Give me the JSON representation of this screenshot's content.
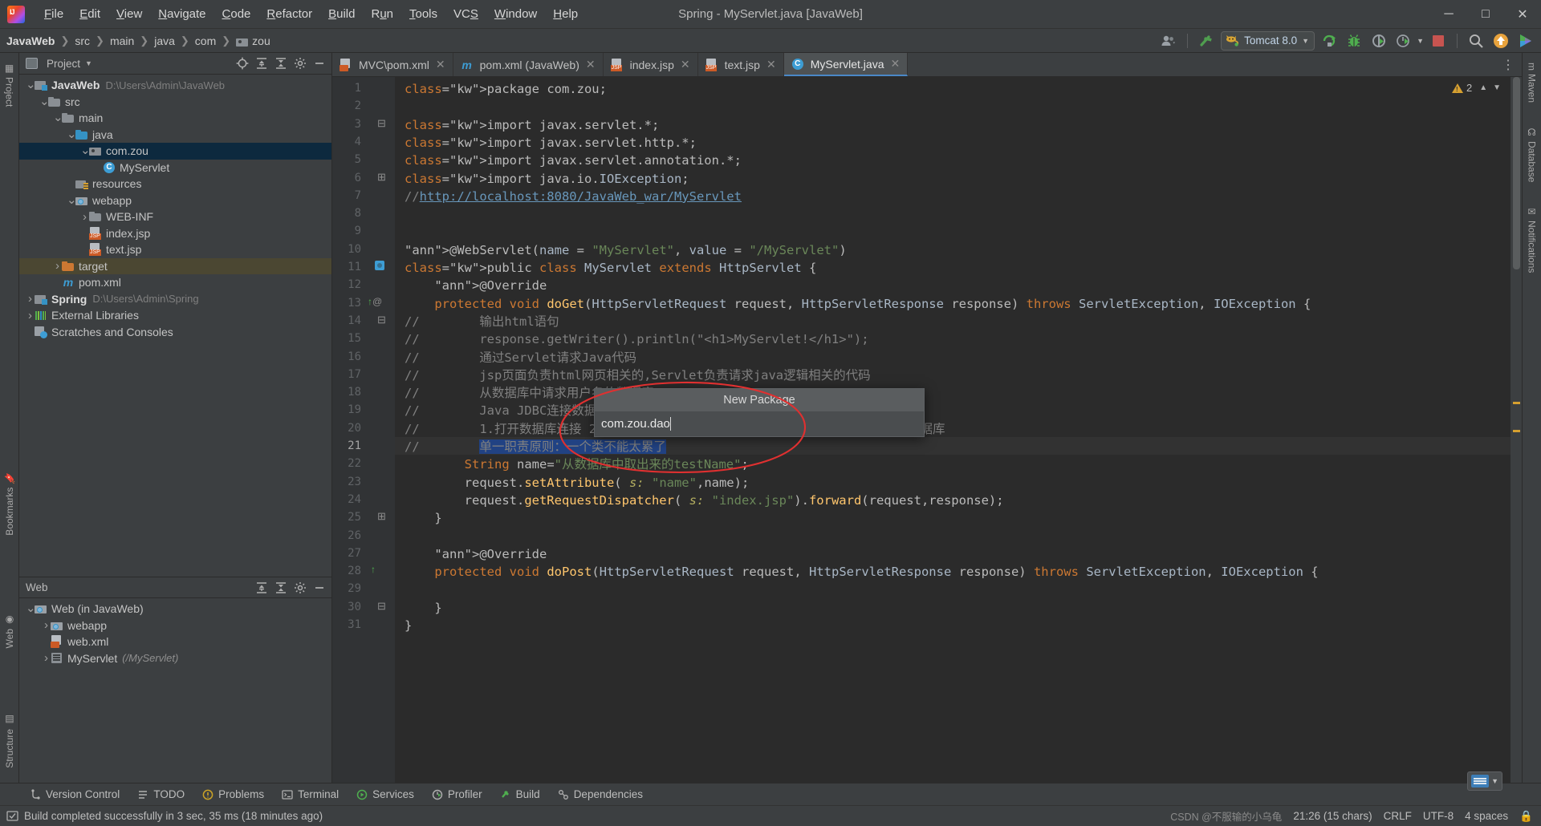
{
  "window": {
    "title": "Spring - MyServlet.java [JavaWeb]",
    "logo_icon": "intellij-idea-logo",
    "minimize_icon": "minimize-icon",
    "maximize_icon": "maximize-icon",
    "close_icon": "close-icon"
  },
  "menu": [
    {
      "label": "File"
    },
    {
      "label": "Edit"
    },
    {
      "label": "View"
    },
    {
      "label": "Navigate"
    },
    {
      "label": "Code"
    },
    {
      "label": "Refactor"
    },
    {
      "label": "Build"
    },
    {
      "label": "Run"
    },
    {
      "label": "Tools"
    },
    {
      "label": "VCS"
    },
    {
      "label": "Window"
    },
    {
      "label": "Help"
    }
  ],
  "breadcrumb": [
    {
      "label": "JavaWeb",
      "bold": true,
      "icon": ""
    },
    {
      "label": "src",
      "bold": false,
      "icon": ""
    },
    {
      "label": "main",
      "bold": false,
      "icon": ""
    },
    {
      "label": "java",
      "bold": false,
      "icon": ""
    },
    {
      "label": "com",
      "bold": false,
      "icon": ""
    },
    {
      "label": "zou",
      "bold": false,
      "icon": "package-icon"
    }
  ],
  "toolbar": {
    "account_icon": "user-account-icon",
    "account_caret": "chevron-down-icon",
    "build_icon": "build-hammer-icon",
    "run_config": {
      "label": "Tomcat 8.0",
      "icon": "tomcat-cat-icon",
      "caret": "chevron-down-icon"
    },
    "run_icon": "run-icon",
    "debug_icon": "debug-bug-icon",
    "run_with_coverage_icon": "run-coverage-icon",
    "profiler_icon": "profiler-icon",
    "profiler_caret": "chevron-down-icon",
    "stop_icon": "stop-icon",
    "search_icon": "search-everywhere-icon",
    "update_icon": "update-project-icon",
    "plugin_icon": "run-anything-icon"
  },
  "project_panel": {
    "title": "Project",
    "title_caret": "chevron-down-icon",
    "actions": [
      "locate-icon",
      "expand-all-icon",
      "collapse-all-icon",
      "settings-gear-icon",
      "hide-panel-icon"
    ],
    "tree": [
      {
        "label": "JavaWeb",
        "path": "D:\\Users\\Admin\\JavaWeb",
        "indent": 0,
        "arrow": "v",
        "icon": "module-icon",
        "bold": true,
        "state": ""
      },
      {
        "label": "src",
        "path": "",
        "indent": 1,
        "arrow": "v",
        "icon": "folder-icon",
        "bold": false,
        "state": ""
      },
      {
        "label": "main",
        "path": "",
        "indent": 2,
        "arrow": "v",
        "icon": "folder-icon",
        "bold": false,
        "state": ""
      },
      {
        "label": "java",
        "path": "",
        "indent": 3,
        "arrow": "v",
        "icon": "source-folder-icon",
        "bold": false,
        "state": ""
      },
      {
        "label": "com.zou",
        "path": "",
        "indent": 4,
        "arrow": "v",
        "icon": "package-icon",
        "bold": false,
        "state": "selected"
      },
      {
        "label": "MyServlet",
        "path": "",
        "indent": 5,
        "arrow": "",
        "icon": "java-class-icon",
        "bold": false,
        "state": ""
      },
      {
        "label": "resources",
        "path": "",
        "indent": 3,
        "arrow": "",
        "icon": "resources-folder-icon",
        "bold": false,
        "state": ""
      },
      {
        "label": "webapp",
        "path": "",
        "indent": 3,
        "arrow": "v",
        "icon": "web-folder-icon",
        "bold": false,
        "state": ""
      },
      {
        "label": "WEB-INF",
        "path": "",
        "indent": 4,
        "arrow": ">",
        "icon": "folder-icon",
        "bold": false,
        "state": ""
      },
      {
        "label": "index.jsp",
        "path": "",
        "indent": 4,
        "arrow": "",
        "icon": "jsp-file-icon",
        "bold": false,
        "state": ""
      },
      {
        "label": "text.jsp",
        "path": "",
        "indent": 4,
        "arrow": "",
        "icon": "jsp-file-icon",
        "bold": false,
        "state": ""
      },
      {
        "label": "target",
        "path": "",
        "indent": 2,
        "arrow": ">",
        "icon": "excluded-folder-icon",
        "bold": false,
        "state": "excluded"
      },
      {
        "label": "pom.xml",
        "path": "",
        "indent": 2,
        "arrow": "",
        "icon": "maven-icon",
        "bold": false,
        "state": ""
      },
      {
        "label": "Spring",
        "path": "D:\\Users\\Admin\\Spring",
        "indent": 0,
        "arrow": ">",
        "icon": "module-icon",
        "bold": true,
        "state": ""
      },
      {
        "label": "External Libraries",
        "path": "",
        "indent": 0,
        "arrow": ">",
        "icon": "libraries-icon",
        "bold": false,
        "state": ""
      },
      {
        "label": "Scratches and Consoles",
        "path": "",
        "indent": 0,
        "arrow": "",
        "icon": "scratches-icon",
        "bold": false,
        "state": ""
      }
    ]
  },
  "web_panel": {
    "title": "Web",
    "actions": [
      "expand-all-icon",
      "collapse-all-icon",
      "settings-gear-icon",
      "hide-panel-icon"
    ],
    "tree": [
      {
        "label": "Web (in JavaWeb)",
        "italic": "",
        "indent": 0,
        "arrow": "v",
        "icon": "web-facet-icon"
      },
      {
        "label": "webapp",
        "italic": "",
        "indent": 1,
        "arrow": ">",
        "icon": "web-folder-icon"
      },
      {
        "label": "web.xml",
        "italic": "",
        "indent": 1,
        "arrow": "",
        "icon": "web-xml-icon"
      },
      {
        "label": "MyServlet",
        "italic": "(/MyServlet)",
        "indent": 1,
        "arrow": ">",
        "icon": "servlet-icon"
      }
    ]
  },
  "left_strip": [
    {
      "label": "Project",
      "icon": "project-icon"
    },
    {
      "label": "Bookmarks",
      "icon": "bookmark-icon"
    },
    {
      "label": "Web",
      "icon": "web-icon"
    },
    {
      "label": "Structure",
      "icon": "structure-icon"
    }
  ],
  "right_strip": [
    {
      "label": "Maven",
      "icon": "maven-icon"
    },
    {
      "label": "Database",
      "icon": "database-icon"
    },
    {
      "label": "Notifications",
      "icon": "notifications-icon"
    }
  ],
  "editor_tabs": [
    {
      "label": "MVC\\pom.xml",
      "icon": "xml-file-icon",
      "active": false
    },
    {
      "label": "pom.xml (JavaWeb)",
      "icon": "maven-icon",
      "active": false
    },
    {
      "label": "index.jsp",
      "icon": "jsp-file-icon",
      "active": false
    },
    {
      "label": "text.jsp",
      "icon": "jsp-file-icon",
      "active": false
    },
    {
      "label": "MyServlet.java",
      "icon": "java-class-icon",
      "active": true
    }
  ],
  "editor": {
    "warning_count": "2",
    "warning_icon": "warning-triangle-icon",
    "inspection_caret": "chevron-down-icon",
    "options_icon": "more-options-icon",
    "code_lines": [
      {
        "n": 1,
        "text": "package com.zou;"
      },
      {
        "n": 2,
        "text": ""
      },
      {
        "n": 3,
        "text": "import javax.servlet.*;"
      },
      {
        "n": 4,
        "text": "import javax.servlet.http.*;"
      },
      {
        "n": 5,
        "text": "import javax.servlet.annotation.*;"
      },
      {
        "n": 6,
        "text": "import java.io.IOException;"
      },
      {
        "n": 7,
        "text": "//http://localhost:8080/JavaWeb_war/MyServlet"
      },
      {
        "n": 8,
        "text": ""
      },
      {
        "n": 9,
        "text": ""
      },
      {
        "n": 10,
        "text": "@WebServlet(name = \"MyServlet\", value = \"/MyServlet\")"
      },
      {
        "n": 11,
        "text": "public class MyServlet extends HttpServlet {"
      },
      {
        "n": 12,
        "text": "    @Override"
      },
      {
        "n": 13,
        "text": "    protected void doGet(HttpServletRequest request, HttpServletResponse response) throws ServletException, IOException {"
      },
      {
        "n": 14,
        "text": "//        输出html语句"
      },
      {
        "n": 15,
        "text": "//        response.getWriter().println(\"<h1>MyServlet!</h1>\");"
      },
      {
        "n": 16,
        "text": "//        通过Servlet请求Java代码"
      },
      {
        "n": 17,
        "text": "//        jsp页面负责html网页相关的,Servlet负责请求java逻辑相关的代码"
      },
      {
        "n": 18,
        "text": "//        从数据库中请求用户名的数据库"
      },
      {
        "n": 19,
        "text": "//        Java JDBC连接数据库步骤"
      },
      {
        "n": 20,
        "text": "//        1.打开数据库连接 2.SQL语句请求数据库得到数据 3.数据处理封装 4.关闭数据库"
      },
      {
        "n": 21,
        "text": "//        单一职责原则：一个类不能太累了"
      },
      {
        "n": 22,
        "text": "        String name=\"从数据库中取出来的testName\";"
      },
      {
        "n": 23,
        "text": "        request.setAttribute( s: \"name\",name);"
      },
      {
        "n": 24,
        "text": "        request.getRequestDispatcher( s: \"index.jsp\").forward(request,response);"
      },
      {
        "n": 25,
        "text": "    }"
      },
      {
        "n": 26,
        "text": ""
      },
      {
        "n": 27,
        "text": "    @Override"
      },
      {
        "n": 28,
        "text": "    protected void doPost(HttpServletRequest request, HttpServletResponse response) throws ServletException, IOException {"
      },
      {
        "n": 29,
        "text": ""
      },
      {
        "n": 30,
        "text": "    }"
      },
      {
        "n": 31,
        "text": "}"
      }
    ],
    "selected_line": 21,
    "selected_text": "单一职责原则：一个类不能太累了"
  },
  "dialog": {
    "title": "New Package",
    "input_value": "com.zou.dao",
    "placeholder": ""
  },
  "annotation": {
    "shape": "red-ellipse-highlight",
    "color": "#e03030"
  },
  "bottom_tools": [
    {
      "label": "Version Control",
      "icon": "version-control-icon"
    },
    {
      "label": "TODO",
      "icon": "todo-icon"
    },
    {
      "label": "Problems",
      "icon": "problems-icon"
    },
    {
      "label": "Terminal",
      "icon": "terminal-icon"
    },
    {
      "label": "Services",
      "icon": "services-icon"
    },
    {
      "label": "Profiler",
      "icon": "profiler-icon"
    },
    {
      "label": "Build",
      "icon": "build-icon"
    },
    {
      "label": "Dependencies",
      "icon": "dependencies-icon"
    }
  ],
  "statusbar": {
    "message": "Build completed successfully in 3 sec, 35 ms (18 minutes ago)",
    "message_icon": "build-status-icon",
    "position": "21:26 (15 chars)",
    "line_separator": "CRLF",
    "encoding": "UTF-8",
    "indent": "4 spaces",
    "lock_icon": "lock-icon",
    "watermark": "CSDN @不服输的小乌龟"
  },
  "ime": {
    "icon": "ime-keyboard-icon",
    "caret": "chevron-down-icon"
  }
}
